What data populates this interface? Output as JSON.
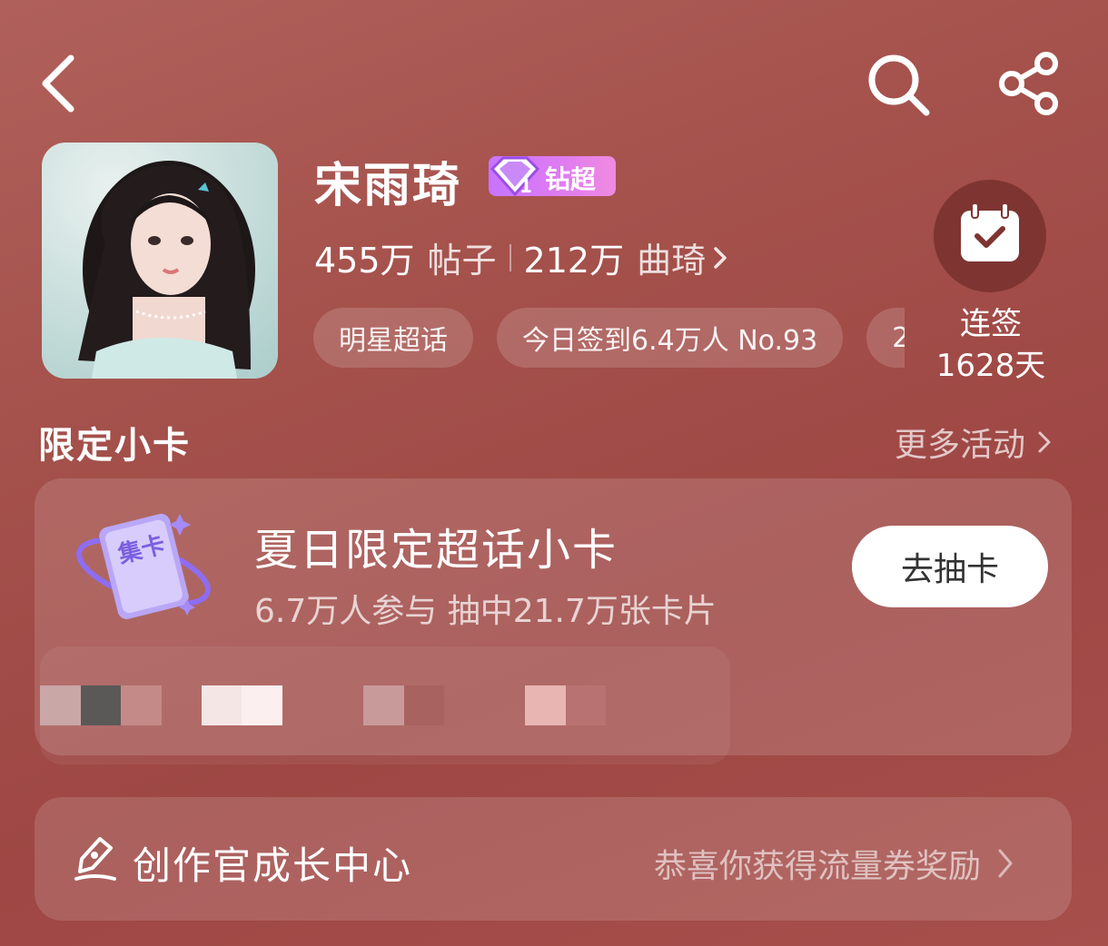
{
  "header": {
    "back_icon": "chevron-left-icon",
    "search_icon": "search-icon",
    "share_icon": "share-icon"
  },
  "profile": {
    "name": "宋雨琦",
    "badge_label": "钻超",
    "badge_level": "1",
    "posts_count": "455万",
    "posts_label": "帖子",
    "fans_count": "212万",
    "fans_label": "曲琦",
    "tags": [
      "明星超话",
      "今日签到6.4万人 No.93",
      "2"
    ]
  },
  "checkin": {
    "label": "连签",
    "days": "1628天"
  },
  "cards_section": {
    "title": "限定小卡",
    "more": "更多活动",
    "card": {
      "icon_text": "集卡",
      "title": "夏日限定超话小卡",
      "subtitle": "6.7万人参与 抽中21.7万张卡片",
      "button": "去抽卡"
    }
  },
  "creator": {
    "title": "创作官成长中心",
    "hint": "恭喜你获得流量券奖励"
  },
  "colors": {
    "background": "#a4504b",
    "badge": "#d97cf5",
    "checkin_circle": "#7e3531",
    "button_bg": "#ffffff"
  }
}
